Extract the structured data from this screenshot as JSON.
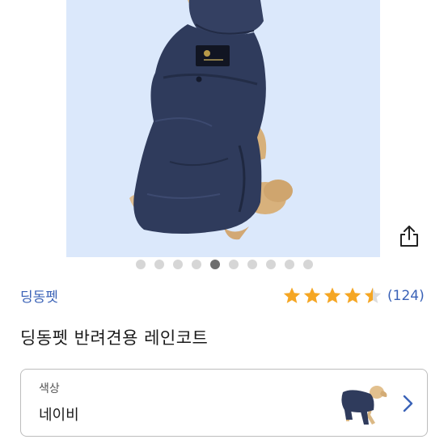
{
  "product": {
    "brand": "딩동펫",
    "title": "딩동펫 반려견용 레인코트",
    "rating": 4.5,
    "review_count": "(124)"
  },
  "carousel": {
    "total": 10,
    "active_index": 4
  },
  "option": {
    "label": "색상",
    "value": "네이비"
  },
  "colors": {
    "accent": "#3a62b7",
    "star": "#f5a623",
    "coat": "#2f3b5c",
    "hero_bg": "#dbe8fb"
  },
  "icons": {
    "share": "share-icon",
    "chevron": "chevron-right-icon",
    "star": "star-icon"
  }
}
